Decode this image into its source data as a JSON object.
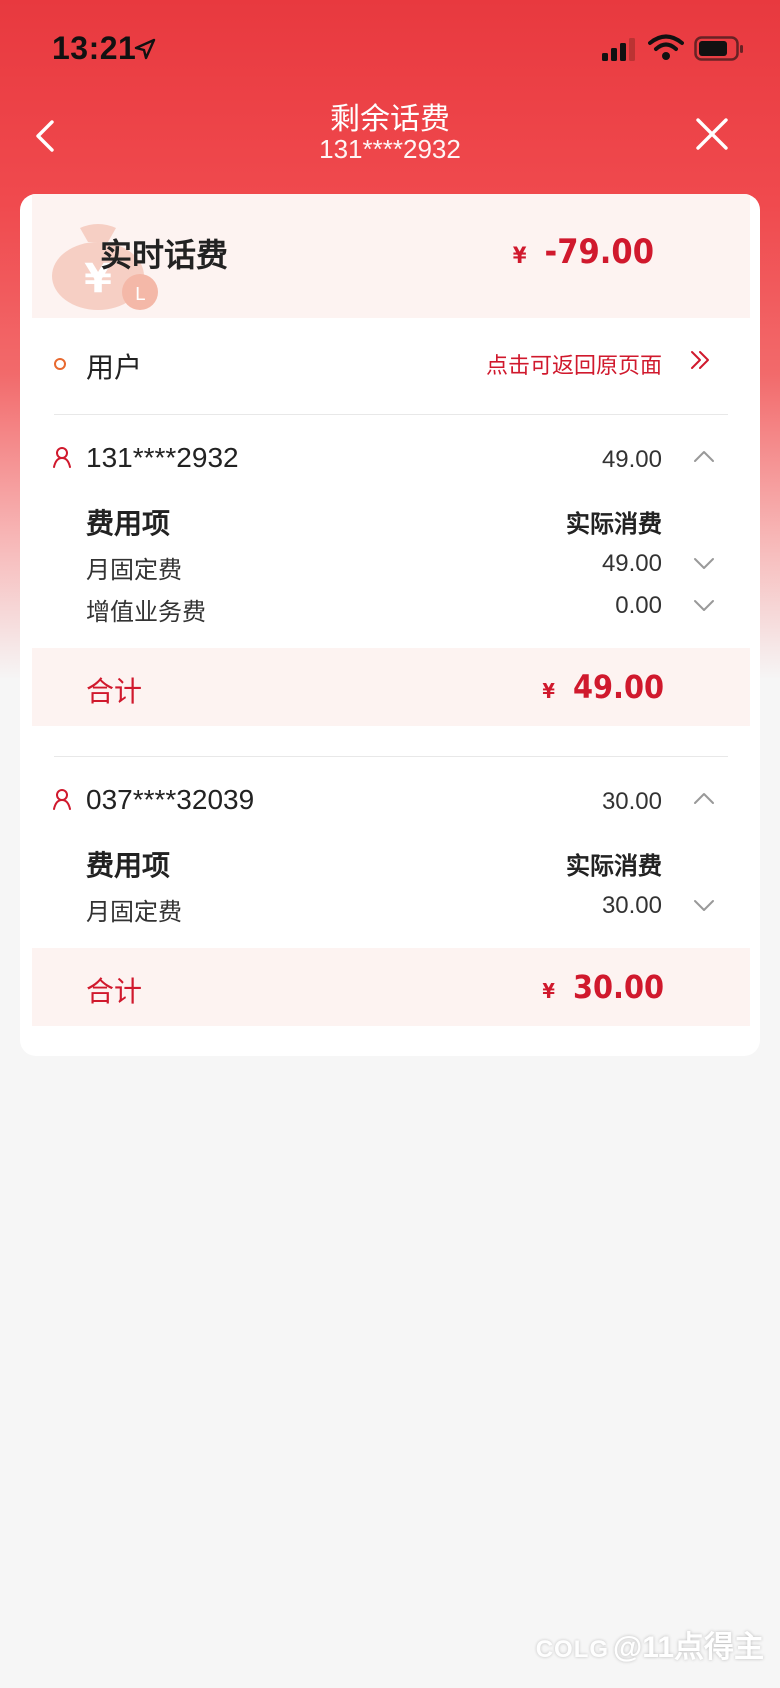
{
  "status_bar": {
    "time": "13:21"
  },
  "nav": {
    "title": "剩余话费",
    "subtitle": "131****2932"
  },
  "realtime": {
    "title": "实时话费",
    "currency": "¥",
    "amount": "-79.00"
  },
  "user_section": {
    "label": "用户",
    "return_link": "点击可返回原页面"
  },
  "accounts": [
    {
      "number": "131****2932",
      "amount": "49.00",
      "header_item": "费用项",
      "header_actual": "实际消费",
      "fees": [
        {
          "name": "月固定费",
          "amount": "49.00"
        },
        {
          "name": "增值业务费",
          "amount": "0.00"
        }
      ],
      "total_label": "合计",
      "total_currency": "¥",
      "total_amount": "49.00"
    },
    {
      "number": "037****32039",
      "amount": "30.00",
      "header_item": "费用项",
      "header_actual": "实际消费",
      "fees": [
        {
          "name": "月固定费",
          "amount": "30.00"
        }
      ],
      "total_label": "合计",
      "total_currency": "¥",
      "total_amount": "30.00"
    }
  ],
  "watermark": {
    "logo": "COLG",
    "text": "@11点得主"
  },
  "colors": {
    "accent_red": "#d0192d",
    "header_red": "#e8393f",
    "pale_pink": "#fdf3f1"
  }
}
